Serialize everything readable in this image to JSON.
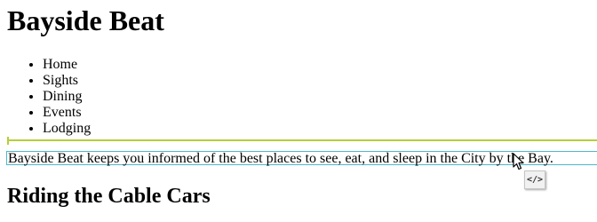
{
  "site": {
    "title": "Bayside Beat"
  },
  "nav": {
    "items": [
      {
        "label": "Home"
      },
      {
        "label": "Sights"
      },
      {
        "label": "Dining"
      },
      {
        "label": "Events"
      },
      {
        "label": "Lodging"
      }
    ]
  },
  "content": {
    "intro": "Bayside Beat keeps you informed of the best places to see, eat, and sleep in the City by the Bay.",
    "heading": "Riding the Cable Cars"
  },
  "overlay": {
    "code_badge_icon": "code-icon",
    "code_badge_text": "</>",
    "cursor_icon": "arrow-cursor-icon",
    "hr_guide_color": "#b5cf3a",
    "paragraph_outline_color": "#4fb7c8"
  }
}
